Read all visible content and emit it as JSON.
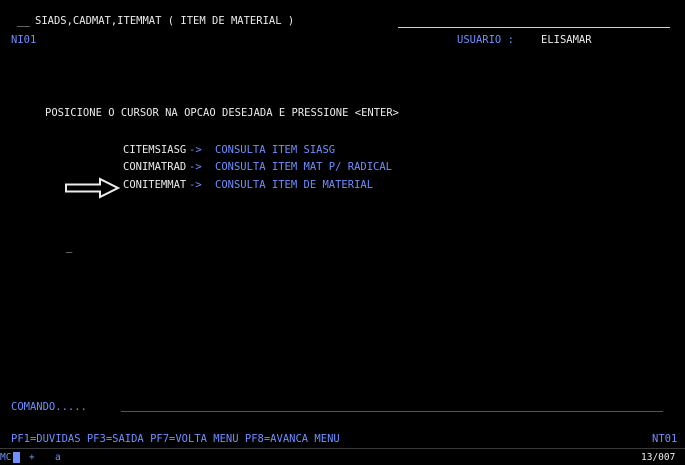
{
  "header": {
    "lead": "__",
    "title": "SIADS,CADMAT,ITEMMAT ( ITEM DE MATERIAL )",
    "screen_id": "NI01",
    "user_label": "USUARIO : ",
    "user_name": "ELISAMAR"
  },
  "prompt": "POSICIONE O CURSOR NA OPCAO DESEJADA E PRESSIONE <ENTER>",
  "options": [
    {
      "code": "CITEMSIASG",
      "arrow": "->",
      "desc": "CONSULTA ITEM SIASG"
    },
    {
      "code": "CONIMATRAD",
      "arrow": "->",
      "desc": "CONSULTA ITEM MAT P/ RADICAL"
    },
    {
      "code": "CONITEMMAT",
      "arrow": "->",
      "desc": "CONSULTA ITEM DE MATERIAL"
    }
  ],
  "cursor_mark": "_",
  "command": {
    "label": "COMANDO.....",
    "value": ""
  },
  "footer": {
    "keys": "PF1=DUVIDAS PF3=SAIDA PF7=VOLTA MENU PF8=AVANCA MENU",
    "code": "NT01"
  },
  "statusbar": {
    "session": "MC",
    "marker": "+",
    "mode": "a",
    "position": "13/007"
  },
  "colors": {
    "text_white": "#ececec",
    "text_blue": "#6f8fff",
    "input_line": "#d1201a",
    "background": "#000000"
  },
  "icons": {
    "selection_arrow": "right-arrow-outline-icon"
  }
}
